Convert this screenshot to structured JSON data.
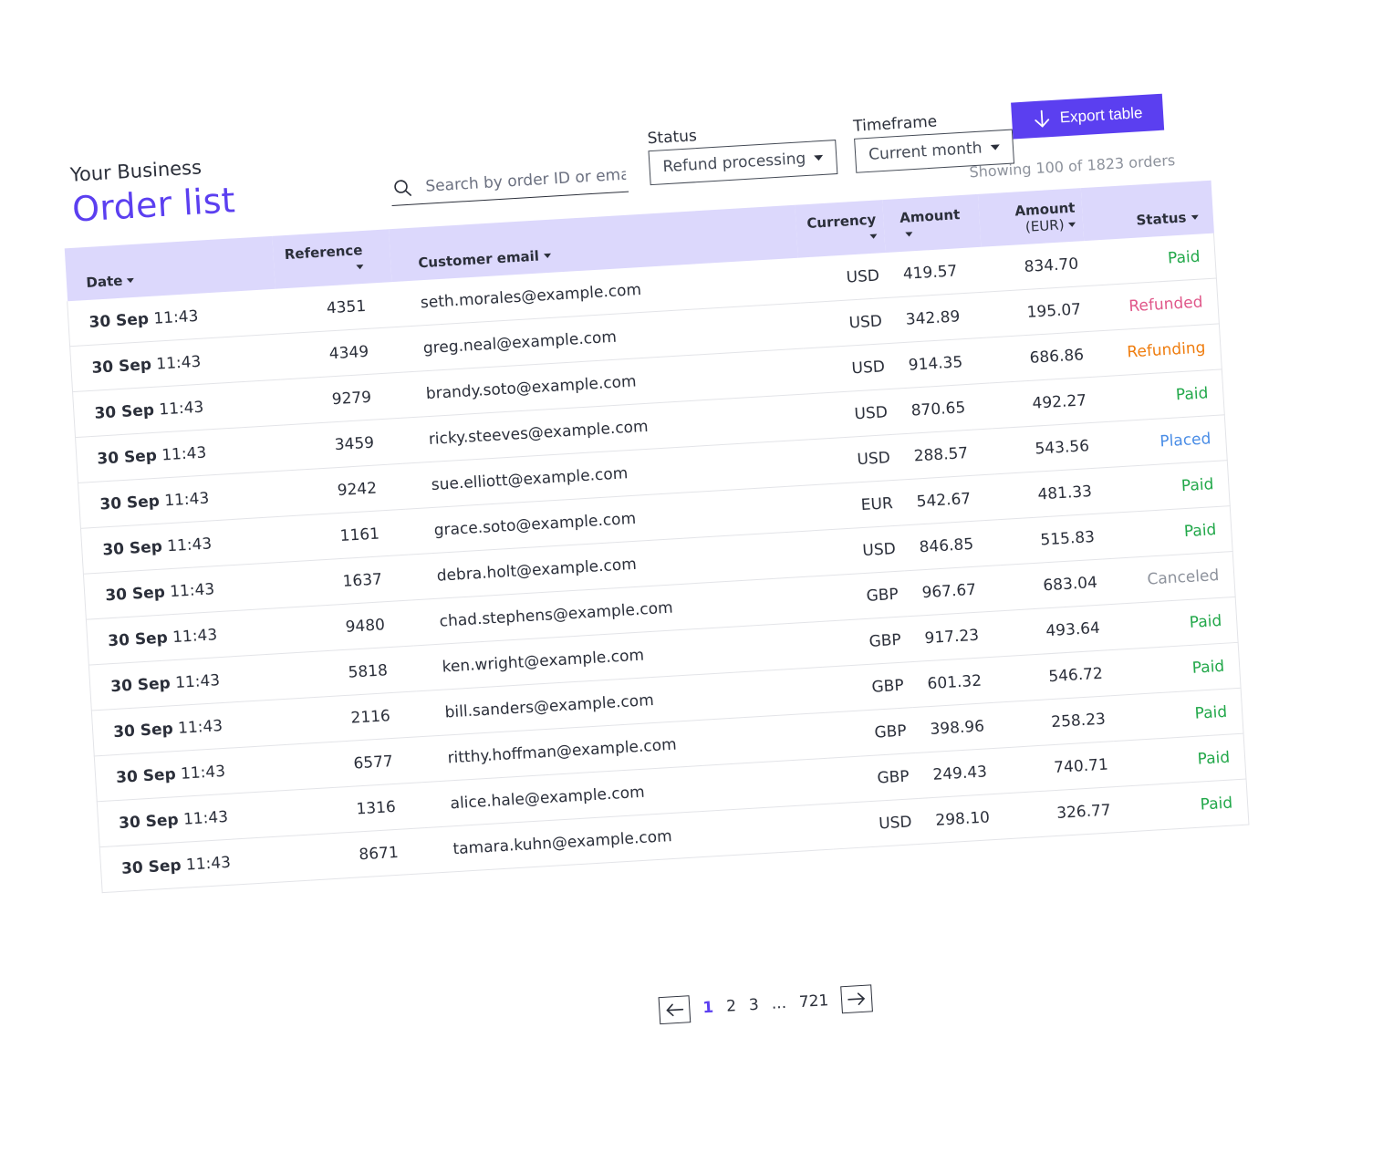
{
  "header": {
    "business": "Your Business",
    "title": "Order list"
  },
  "search": {
    "placeholder": "Search by order ID or email",
    "icon": "search-icon"
  },
  "filters": {
    "status_label": "Status",
    "status_value": "Refund processing",
    "timeframe_label": "Timeframe",
    "timeframe_value": "Current month"
  },
  "export": {
    "label": "Export table",
    "icon": "arrow-down-icon"
  },
  "summary": "Showing 100 of 1823 orders",
  "table": {
    "headers": {
      "date": "Date",
      "reference": "Reference",
      "email": "Customer email",
      "currency": "Currency",
      "amount": "Amount",
      "amount_eur": "Amount",
      "amount_eur_unit": "(EUR)",
      "status": "Status"
    },
    "rows": [
      {
        "day": "30 Sep",
        "time": "11:43",
        "ref": "4351",
        "email": "seth.morales@example.com",
        "currency": "USD",
        "amount": "419.57",
        "eur": "834.70",
        "status": "Paid",
        "color": "#22a84a"
      },
      {
        "day": "30 Sep",
        "time": "11:43",
        "ref": "4349",
        "email": "greg.neal@example.com",
        "currency": "USD",
        "amount": "342.89",
        "eur": "195.07",
        "status": "Refunded",
        "color": "#e0588a"
      },
      {
        "day": "30 Sep",
        "time": "11:43",
        "ref": "9279",
        "email": "brandy.soto@example.com",
        "currency": "USD",
        "amount": "914.35",
        "eur": "686.86",
        "status": "Refunding",
        "color": "#ef7d0f"
      },
      {
        "day": "30 Sep",
        "time": "11:43",
        "ref": "3459",
        "email": "ricky.steeves@example.com",
        "currency": "USD",
        "amount": "870.65",
        "eur": "492.27",
        "status": "Paid",
        "color": "#22a84a"
      },
      {
        "day": "30 Sep",
        "time": "11:43",
        "ref": "9242",
        "email": "sue.elliott@example.com",
        "currency": "USD",
        "amount": "288.57",
        "eur": "543.56",
        "status": "Placed",
        "color": "#4a8de6"
      },
      {
        "day": "30 Sep",
        "time": "11:43",
        "ref": "1161",
        "email": "grace.soto@example.com",
        "currency": "EUR",
        "amount": "542.67",
        "eur": "481.33",
        "status": "Paid",
        "color": "#22a84a"
      },
      {
        "day": "30 Sep",
        "time": "11:43",
        "ref": "1637",
        "email": "debra.holt@example.com",
        "currency": "USD",
        "amount": "846.85",
        "eur": "515.83",
        "status": "Paid",
        "color": "#22a84a"
      },
      {
        "day": "30 Sep",
        "time": "11:43",
        "ref": "9480",
        "email": "chad.stephens@example.com",
        "currency": "GBP",
        "amount": "967.67",
        "eur": "683.04",
        "status": "Canceled",
        "color": "#8d929c"
      },
      {
        "day": "30 Sep",
        "time": "11:43",
        "ref": "5818",
        "email": "ken.wright@example.com",
        "currency": "GBP",
        "amount": "917.23",
        "eur": "493.64",
        "status": "Paid",
        "color": "#22a84a"
      },
      {
        "day": "30 Sep",
        "time": "11:43",
        "ref": "2116",
        "email": "bill.sanders@example.com",
        "currency": "GBP",
        "amount": "601.32",
        "eur": "546.72",
        "status": "Paid",
        "color": "#22a84a"
      },
      {
        "day": "30 Sep",
        "time": "11:43",
        "ref": "6577",
        "email": "ritthy.hoffman@example.com",
        "currency": "GBP",
        "amount": "398.96",
        "eur": "258.23",
        "status": "Paid",
        "color": "#22a84a"
      },
      {
        "day": "30 Sep",
        "time": "11:43",
        "ref": "1316",
        "email": "alice.hale@example.com",
        "currency": "GBP",
        "amount": "249.43",
        "eur": "740.71",
        "status": "Paid",
        "color": "#22a84a"
      },
      {
        "day": "30 Sep",
        "time": "11:43",
        "ref": "8671",
        "email": "tamara.kuhn@example.com",
        "currency": "USD",
        "amount": "298.10",
        "eur": "326.77",
        "status": "Paid",
        "color": "#22a84a"
      }
    ]
  },
  "pagination": {
    "pages": [
      "1",
      "2",
      "3"
    ],
    "ellipsis": "...",
    "last": "721",
    "current": "1",
    "prev_icon": "arrow-left-icon",
    "next_icon": "arrow-right-icon"
  },
  "colors": {
    "accent": "#5b3ff0",
    "header_bg": "#dcd8fc"
  }
}
